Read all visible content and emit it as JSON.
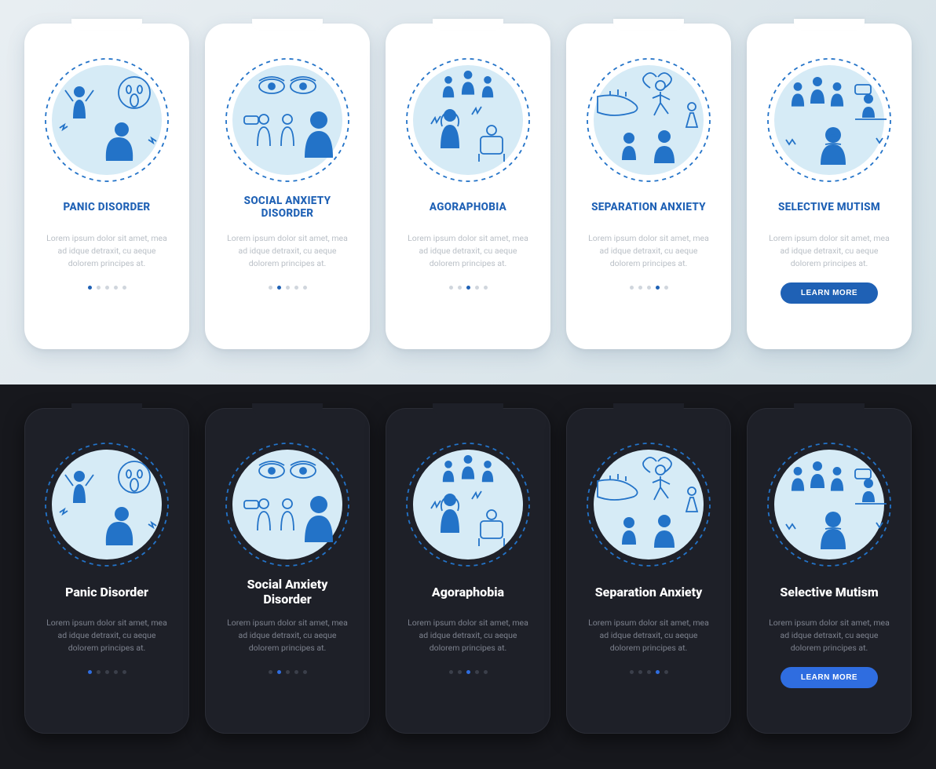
{
  "colors": {
    "accent_light": "#1f61b5",
    "accent_dark": "#2f6de0",
    "bg_dark": "#17181d",
    "card_dark": "#1e2028",
    "text_muted_light": "#b9bfc6",
    "text_muted_dark": "#7d828e"
  },
  "shared": {
    "desc": "Lorem ipsum dolor sit amet, mea ad idque detraxit, cu aeque dolorem principes at.",
    "button_label": "LEARN MORE",
    "dot_count": 5
  },
  "light": {
    "screens": [
      {
        "title": "PANIC DISORDER",
        "active_dot": 0,
        "icon": "panic-disorder-icon",
        "has_button": false
      },
      {
        "title": "SOCIAL ANXIETY DISORDER",
        "active_dot": 1,
        "icon": "social-anxiety-icon",
        "has_button": false
      },
      {
        "title": "AGORAPHOBIA",
        "active_dot": 2,
        "icon": "agoraphobia-icon",
        "has_button": false
      },
      {
        "title": "SEPARATION ANXIETY",
        "active_dot": 3,
        "icon": "separation-anxiety-icon",
        "has_button": false
      },
      {
        "title": "SELECTIVE MUTISM",
        "active_dot": 4,
        "icon": "selective-mutism-icon",
        "has_button": true
      }
    ]
  },
  "dark": {
    "screens": [
      {
        "title": "Panic Disorder",
        "active_dot": 0,
        "icon": "panic-disorder-icon",
        "has_button": false
      },
      {
        "title": "Social Anxiety Disorder",
        "active_dot": 1,
        "icon": "social-anxiety-icon",
        "has_button": false
      },
      {
        "title": "Agoraphobia",
        "active_dot": 2,
        "icon": "agoraphobia-icon",
        "has_button": false
      },
      {
        "title": "Separation Anxiety",
        "active_dot": 3,
        "icon": "separation-anxiety-icon",
        "has_button": false
      },
      {
        "title": "Selective Mutism",
        "active_dot": 4,
        "icon": "selective-mutism-icon",
        "has_button": true
      }
    ]
  }
}
